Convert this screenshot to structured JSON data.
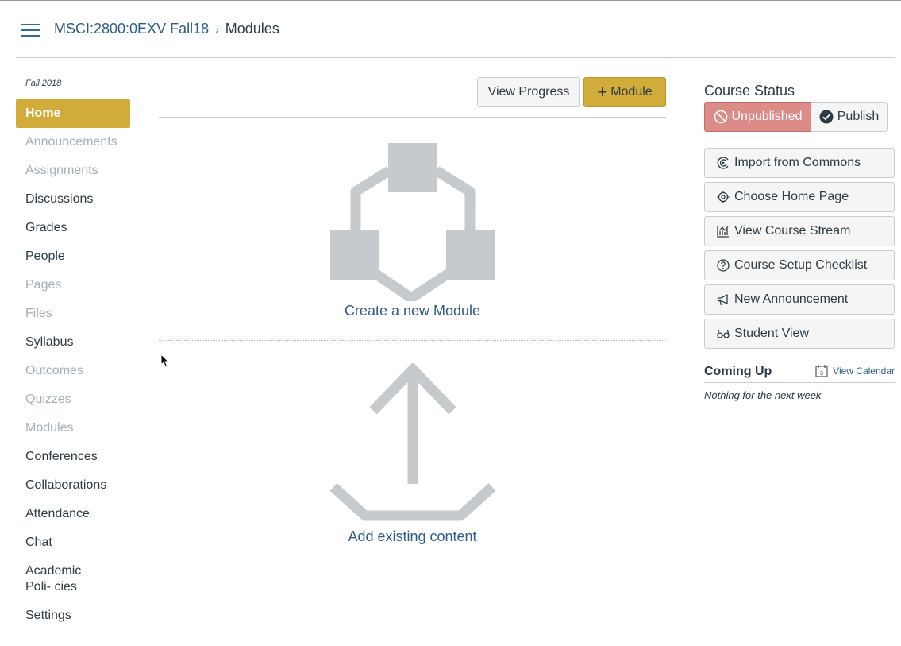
{
  "header": {
    "course": "MSCI:2800:0EXV Fall18",
    "separator": "›",
    "page": "Modules"
  },
  "sidebar": {
    "term": "Fall 2018",
    "items": [
      {
        "label": "Home",
        "state": "active"
      },
      {
        "label": "Announcements",
        "state": "disabled"
      },
      {
        "label": "Assignments",
        "state": "disabled"
      },
      {
        "label": "Discussions",
        "state": "normal"
      },
      {
        "label": "Grades",
        "state": "normal"
      },
      {
        "label": "People",
        "state": "normal"
      },
      {
        "label": "Pages",
        "state": "disabled"
      },
      {
        "label": "Files",
        "state": "disabled"
      },
      {
        "label": "Syllabus",
        "state": "normal"
      },
      {
        "label": "Outcomes",
        "state": "disabled"
      },
      {
        "label": "Quizzes",
        "state": "disabled"
      },
      {
        "label": "Modules",
        "state": "disabled"
      },
      {
        "label": "Conferences",
        "state": "normal"
      },
      {
        "label": "Collaborations",
        "state": "normal"
      },
      {
        "label": "Attendance",
        "state": "normal"
      },
      {
        "label": "Chat",
        "state": "normal"
      },
      {
        "label": "Academic Poli- cies",
        "state": "normal"
      },
      {
        "label": "Settings",
        "state": "normal"
      }
    ]
  },
  "toolbar": {
    "view_progress": "View Progress",
    "add_module": "Module"
  },
  "main": {
    "create_module": "Create a new Module",
    "add_existing": "Add existing content"
  },
  "course_status": {
    "title": "Course Status",
    "unpublished": "Unpublished",
    "publish": "Publish"
  },
  "actions": [
    {
      "label": "Import from Commons",
      "icon": "commons-icon"
    },
    {
      "label": "Choose Home Page",
      "icon": "target-icon"
    },
    {
      "label": "View Course Stream",
      "icon": "stream-chart-icon"
    },
    {
      "label": "Course Setup Checklist",
      "icon": "question-icon"
    },
    {
      "label": "New Announcement",
      "icon": "megaphone-icon"
    },
    {
      "label": "Student View",
      "icon": "glasses-icon"
    }
  ],
  "coming_up": {
    "title": "Coming Up",
    "calendar_day": "3",
    "view_calendar": "View Calendar",
    "empty": "Nothing for the next week"
  },
  "colors": {
    "accent": "#d2ac3a",
    "link": "#2d5b8a",
    "unpublished": "#dc8b88",
    "illustration": "#c7cacd"
  }
}
